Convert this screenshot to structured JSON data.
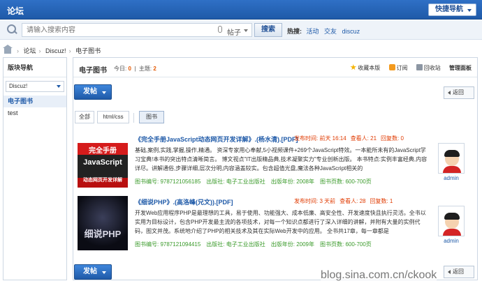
{
  "header": {
    "title": "论坛",
    "quick_nav": "快捷导航"
  },
  "search": {
    "placeholder": "请输入搜索内容",
    "scope": "帖子",
    "button": "搜索",
    "hot_label": "热搜:",
    "hot_terms": [
      "活动",
      "交友",
      "discuz"
    ]
  },
  "breadcrumb": [
    "论坛",
    "Discuz!",
    "电子图书"
  ],
  "sidebar": {
    "title": "版块导航",
    "select": "Discuz!",
    "items": [
      "电子图书",
      "test"
    ]
  },
  "forum": {
    "name": "电子图书",
    "today_label": "今日:",
    "today": "0",
    "topics_label": "主题:",
    "topics": "2",
    "actions": {
      "favorite": "收藏本版",
      "subscribe": "订阅",
      "recycle": "回收站",
      "admin": "管理面板"
    }
  },
  "buttons": {
    "post": "发帖",
    "back": "返回"
  },
  "tabs": [
    "全部",
    "html/css",
    "图书"
  ],
  "threads": [
    {
      "cover_text": [
        "完全手册",
        "JavaScript",
        "动态网页开发详解"
      ],
      "title": "《完全手册JavaScript动态网页开发详解》.(杨水清).[PDF]",
      "posted": "发布时间: 前天 16:14",
      "views": "查看人: 21",
      "replies": "回复数: 0",
      "desc": "基础,案例,实践,掌握,操作,精通。 资深专家用心奉献,5小视频课件+269个JavaScript特效。一本能所未有的JavaScript学习宝典!本书的突出特点清晰简言。 博文视点\"IT出版精品典,技术凝聚实力\"专业创新出版。 本书特点:实例丰富经典,内容详尽。讲解通俗,步骤详细,层次分明,内容涵盖较实。包含超值光盘,魔法各种JavaScript相关的",
      "isbn": "图书编号: 9787121056185",
      "publisher": "出版社: 电子工业出版社",
      "year": "出版年份: 2008年",
      "pages": "图书页数: 600-700页",
      "author": "admin"
    },
    {
      "cover_text": [
        "细说PHP"
      ],
      "title": "《细说PHP》.(高洛峰(兄文)).[PDF]",
      "posted": "发布时间: 3 天前",
      "views": "查看人: 28",
      "replies": "回复数: 1",
      "desc": "开发Web应用程序PHP是最理想的工具，易于使用、功能强大、成本低廉、高安全性、开发速度快且执行灵活。全书以实用为目标设计，包含PHP开发最主流的各项技术，对每一个知识点都进行了深入详细的讲解，并附有大量的实例代码，图文并茂。系统地介绍了PHP的相关技术及其在实际Web开发中的应用。 全书共17章，每一章都是",
      "isbn": "图书编号: 9787121094415",
      "publisher": "出版社: 电子工业出版社",
      "year": "出版年份: 2009年",
      "pages": "图书页数: 600-700页",
      "author": "admin"
    }
  ],
  "watermark": "blog.sina.com.cn/ckook"
}
